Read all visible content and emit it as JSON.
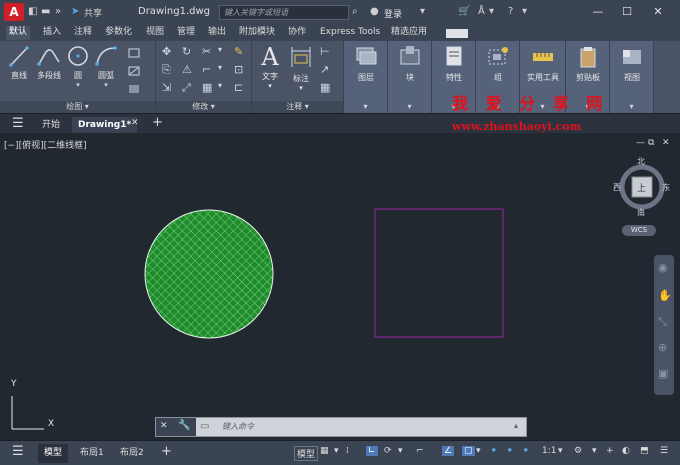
{
  "titlebar": {
    "app_logo": "A",
    "share_label": "共享",
    "doc_title": "Drawing1.dwg",
    "search_placeholder": "键入关键字或短语",
    "login_label": "登录"
  },
  "ribbon_tabs": [
    "默认",
    "插入",
    "注释",
    "参数化",
    "视图",
    "管理",
    "输出",
    "附加模块",
    "协作",
    "Express Tools",
    "精选应用"
  ],
  "ribbon": {
    "draw": {
      "line": "直线",
      "polyline": "多段线",
      "circle": "圆",
      "arc": "圆弧",
      "footer": "绘图"
    },
    "modify": {
      "footer": "修改"
    },
    "annotation": {
      "text": "文字",
      "dimension": "标注",
      "footer": "注释"
    },
    "layers": {
      "label": "图层"
    },
    "block": {
      "label": "块"
    },
    "properties": {
      "label": "特性"
    },
    "groups": {
      "label": "组"
    },
    "utilities": {
      "label": "实用工具"
    },
    "clipboard": {
      "label": "剪贴板"
    },
    "view": {
      "label": "视图"
    }
  },
  "file_tabs": {
    "start": "开始",
    "drawing": "Drawing1*"
  },
  "canvas": {
    "view_label": "[−][俯视][二维线框]",
    "watermark_cn": "我 爱 分 享 网",
    "watermark_url": "www.zhanshaoyi.com",
    "viewcube": {
      "north": "北",
      "south": "南",
      "east": "东",
      "west": "西",
      "top": "上",
      "wcs": "WCS"
    },
    "ucs_x": "X",
    "ucs_y": "Y"
  },
  "command": {
    "placeholder": "键入命令"
  },
  "status": {
    "model_tab": "模型",
    "layout1": "布局1",
    "layout2": "布局2",
    "model_btn": "模型",
    "scale": "1:1"
  },
  "colors": {
    "hatch_fill": "#1e8c2b",
    "rect_stroke": "#a020a0",
    "accent": "#d11f2a"
  }
}
